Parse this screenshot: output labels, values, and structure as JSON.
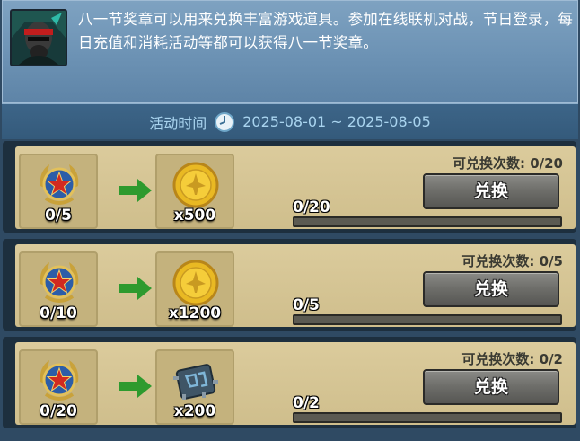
{
  "header": {
    "description": "八一节奖章可以用来兑换丰富游戏道具。参加在线联机对战，节日登录，每日充值和消耗活动等都可以获得八一节奖章。",
    "time_label": "活动时间",
    "time_range": "2025-08-01 ~ 2025-08-05"
  },
  "rows": [
    {
      "cost_qty": "0/5",
      "reward_qty": "x500",
      "reward_icon": "gold-coin-icon",
      "progress_text": "0/20",
      "progress": 0,
      "count_text": "可兑换次数: 0/20",
      "button_label": "兑换"
    },
    {
      "cost_qty": "0/10",
      "reward_qty": "x1200",
      "reward_icon": "gold-coin-icon",
      "progress_text": "0/5",
      "progress": 0,
      "count_text": "可兑换次数: 0/5",
      "button_label": "兑换"
    },
    {
      "cost_qty": "0/20",
      "reward_qty": "x200",
      "reward_icon": "chip-icon",
      "progress_text": "0/2",
      "progress": 0,
      "count_text": "可兑换次数: 0/2",
      "button_label": "兑换"
    }
  ],
  "colors": {
    "arrow": "#2e9a2e",
    "coin": "#e9b923",
    "medal_star": "#d22a20"
  }
}
